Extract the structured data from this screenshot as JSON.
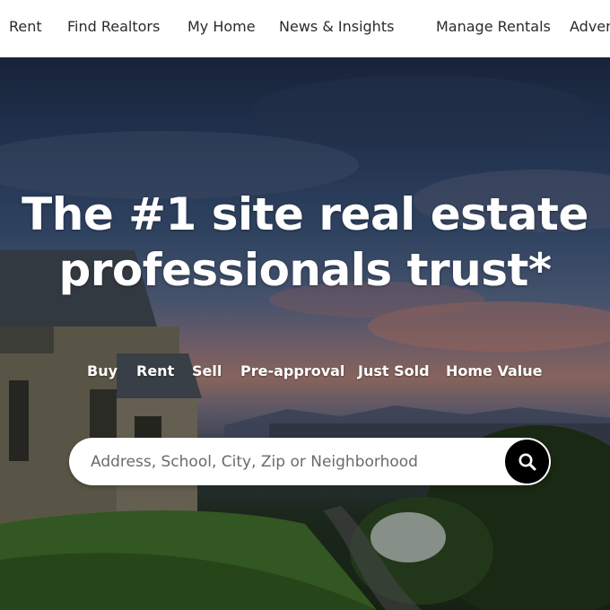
{
  "nav": {
    "items": [
      {
        "label": "Rent"
      },
      {
        "label": "Find Realtors"
      },
      {
        "label": "My Home"
      },
      {
        "label": "News & Insights"
      },
      {
        "label": "Manage Rentals"
      },
      {
        "label": "Adver"
      }
    ]
  },
  "hero": {
    "headline_line1": "The #1 site real estate",
    "headline_line2": "professionals trust*",
    "tabs": [
      {
        "label": "Buy"
      },
      {
        "label": "Rent"
      },
      {
        "label": "Sell"
      },
      {
        "label": "Pre-approval"
      },
      {
        "label": "Just Sold"
      },
      {
        "label": "Home Value"
      }
    ],
    "search": {
      "placeholder": "Address, School, City, Zip or Neighborhood"
    }
  },
  "icons": {
    "search_button": "search-icon"
  },
  "colors": {
    "nav_text": "#2b2b2b",
    "hero_text": "#ffffff",
    "search_button_bg": "#000000"
  }
}
